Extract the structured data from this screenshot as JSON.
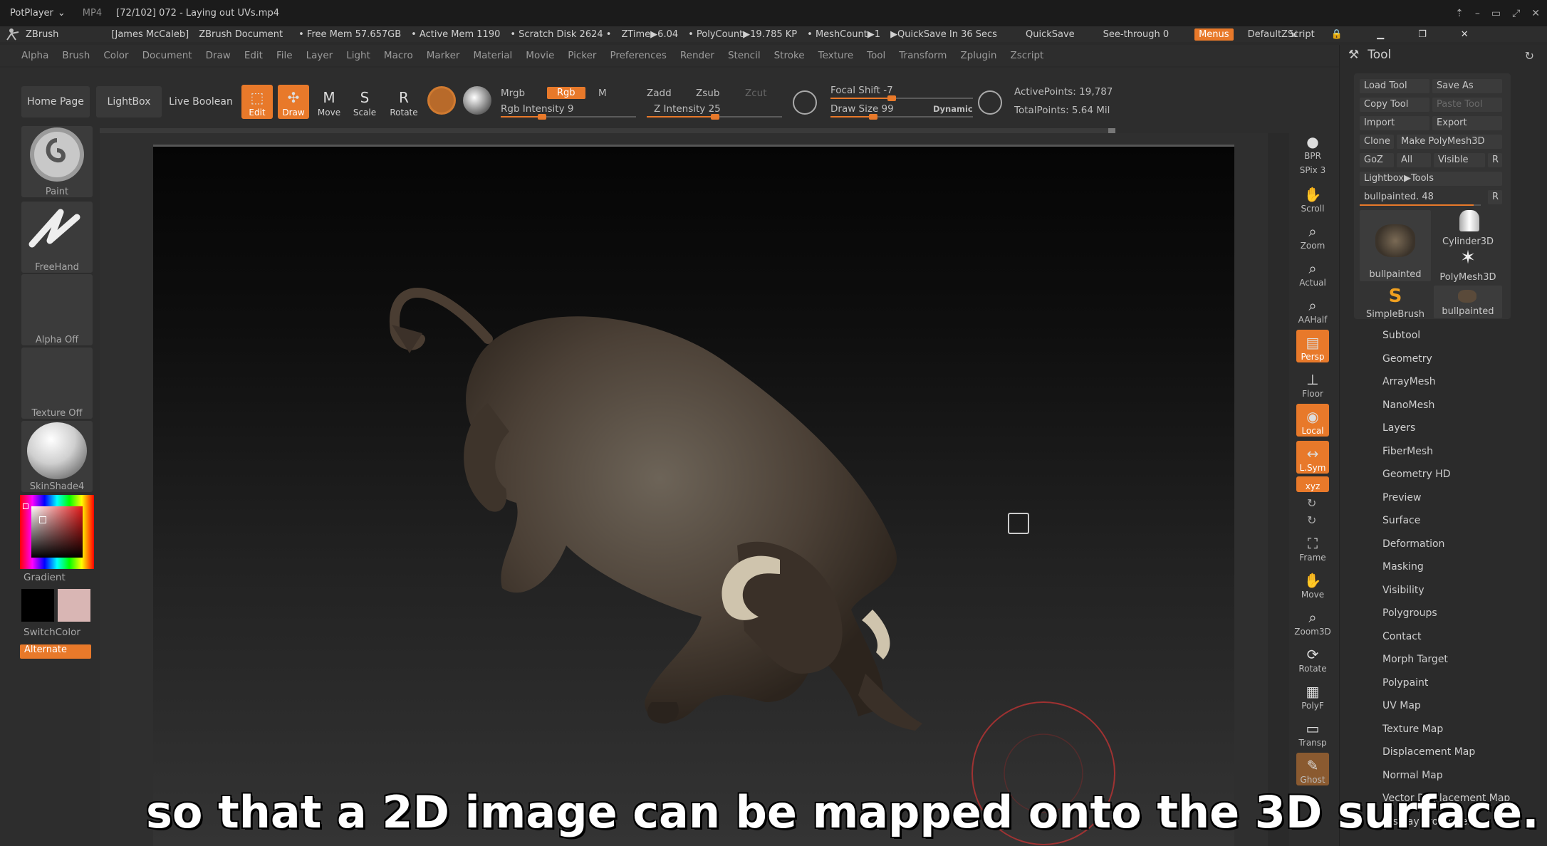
{
  "player": {
    "app_name": "PotPlayer",
    "format": "MP4",
    "title": "[72/102] 072 - Laying out UVs.mp4",
    "controls": [
      "⇡",
      "–",
      "▭",
      "⤢",
      "✕"
    ]
  },
  "zbrush_title": {
    "app": "ZBrush",
    "user": "[James McCaleb]",
    "doc": "ZBrush Document",
    "free_mem": "• Free Mem 57.657GB",
    "active_mem": "• Active Mem 1190",
    "scratch": "• Scratch Disk 2624 •",
    "ztime": "ZTime▶6.04",
    "polycount": "• PolyCount▶19.785 KP",
    "meshcount": "• MeshCount▶1",
    "quicksave_in": "▶QuickSave In 36 Secs",
    "quicksave": "QuickSave",
    "see_through": "See-through   0",
    "menus": "Menus",
    "zscript": "DefaultZScript"
  },
  "menu_bar": {
    "items": [
      "Alpha",
      "Brush",
      "Color",
      "Document",
      "Draw",
      "Edit",
      "File",
      "Layer",
      "Light",
      "Macro",
      "Marker",
      "Material",
      "Movie",
      "Picker",
      "Preferences",
      "Render",
      "Stencil",
      "Stroke",
      "Texture",
      "Tool",
      "Transform",
      "Zplugin",
      "Zscript"
    ]
  },
  "shelf": {
    "home_page": "Home Page",
    "lightbox": "LightBox",
    "live_boolean": "Live Boolean",
    "edit": "Edit",
    "draw": "Draw",
    "move": "Move",
    "scale": "Scale",
    "rotate": "Rotate",
    "mrgb": "Mrgb",
    "rgb": "Rgb",
    "m": "M",
    "rgb_intensity": "Rgb Intensity 9",
    "zadd": "Zadd",
    "zsub": "Zsub",
    "zcut": "Zcut",
    "z_intensity": "Z Intensity 25",
    "focal_shift": "Focal Shift -7",
    "draw_size": "Draw Size 99",
    "dynamic": "Dynamic",
    "active_points": "ActivePoints: 19,787",
    "total_points": "TotalPoints: 5.64 Mil",
    "rgb_intensity_value": 9,
    "z_intensity_value": 25,
    "focal_shift_value": -7,
    "draw_size_value": 99
  },
  "left_shelf": {
    "brush": "Paint",
    "stroke": "FreeHand",
    "alpha": "Alpha Off",
    "texture": "Texture Off",
    "material": "SkinShade4",
    "gradient": "Gradient",
    "switch_color": "SwitchColor",
    "alternate": "Alternate"
  },
  "right_shelf": {
    "items": [
      {
        "label": "BPR",
        "icon": "render-sphere-icon"
      },
      {
        "label": "SPix 3",
        "icon": "spix-icon"
      },
      {
        "label": "Scroll",
        "icon": "hand-icon"
      },
      {
        "label": "Zoom",
        "icon": "zoom-icon"
      },
      {
        "label": "Actual",
        "icon": "actual-icon"
      },
      {
        "label": "AAHalf",
        "icon": "aahalf-icon"
      },
      {
        "label": "Persp",
        "icon": "persp-icon"
      },
      {
        "label": "Floor",
        "icon": "floor-icon"
      },
      {
        "label": "Local",
        "icon": "local-icon"
      },
      {
        "label": "L.Sym",
        "icon": "lsym-icon"
      },
      {
        "label": "xyz",
        "icon": "xyz-icon"
      },
      {
        "label": "Frame",
        "icon": "frame-icon"
      },
      {
        "label": "Move",
        "icon": "move-icon"
      },
      {
        "label": "Zoom3D",
        "icon": "zoom3d-icon"
      },
      {
        "label": "Rotate",
        "icon": "rotate-icon"
      },
      {
        "label": "PolyF",
        "icon": "polyf-icon"
      },
      {
        "label": "Transp",
        "icon": "transp-icon"
      },
      {
        "label": "Ghost",
        "icon": "ghost-icon"
      }
    ]
  },
  "tool_panel": {
    "header": "Tool",
    "load_tool": "Load Tool",
    "save_as": "Save As",
    "copy_tool": "Copy Tool",
    "paste_tool": "Paste Tool",
    "import": "Import",
    "export": "Export",
    "clone": "Clone",
    "make_polymesh": "Make PolyMesh3D",
    "goz": "GoZ",
    "all": "All",
    "visible": "Visible",
    "r": "R",
    "lightbox_tools": "Lightbox▶Tools",
    "current_tool": "bullpainted. 48",
    "thumbs": {
      "bullpainted": "bullpainted",
      "cylinder": "Cylinder3D",
      "polymesh": "PolyMesh3D",
      "simplebrush": "SimpleBrush",
      "bullpainted2": "bullpainted"
    },
    "subpalettes": [
      "Subtool",
      "Geometry",
      "ArrayMesh",
      "NanoMesh",
      "Layers",
      "FiberMesh",
      "Geometry HD",
      "Preview",
      "Surface",
      "Deformation",
      "Masking",
      "Visibility",
      "Polygroups",
      "Contact",
      "Morph Target",
      "Polypaint",
      "UV Map",
      "Texture Map",
      "Displacement Map",
      "Normal Map",
      "Vector Displacement Map",
      "Display Properties"
    ]
  },
  "subtitle": "so that a 2D image can be mapped onto the 3D surface.",
  "colors": {
    "accent": "#e8792a",
    "panel": "#2d2d2d"
  }
}
